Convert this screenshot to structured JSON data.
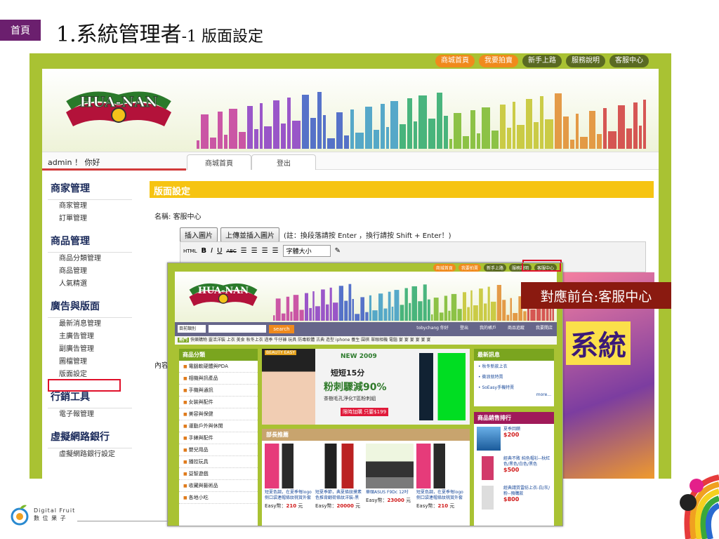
{
  "slide": {
    "home_tab": "首頁",
    "title_main": "1.系統管理者",
    "title_sub": "-1 版面設定"
  },
  "admin": {
    "topnav": [
      "商城首頁",
      "我要拍賣",
      "新手上路",
      "服務說明",
      "客服中心"
    ],
    "logo_text": "HUA-NAN",
    "greeting": "admin ！ 你好",
    "tabs": [
      "商城首頁",
      "登出"
    ],
    "sidebar": [
      {
        "head": "商家管理",
        "items": [
          "商家管理",
          "訂單管理"
        ]
      },
      {
        "head": "商品管理",
        "items": [
          "商品分類管理",
          "商品管理",
          "人氣精選"
        ]
      },
      {
        "head": "廣告與版面",
        "items": [
          "最新消息管理",
          "主廣告管理",
          "副廣告管理",
          "圖檔管理",
          "版面設定"
        ]
      },
      {
        "head": "行銷工具",
        "items": [
          "電子報管理"
        ]
      },
      {
        "head": "虛擬網路銀行",
        "items": [
          "虛擬網路銀行設定"
        ]
      }
    ],
    "content_header": "版面設定",
    "name_label": "名稱:",
    "name_value": "客服中心",
    "insert_image_button": "插入圖片",
    "upload_insert_button": "上傳並插入圖片",
    "note": "(註：換段落請按 Enter ，換行請按 Shift + Enter！)",
    "font_size_select": "字體大小",
    "content_label": "內容",
    "preview_text": "系統"
  },
  "shop": {
    "topnav": [
      "商城首頁",
      "我要拍賣",
      "新手上路",
      "服務說明",
      "客服中心"
    ],
    "logo_text": "HUA-NAN",
    "category_select": "目前類別",
    "search_button": "search",
    "user": "tobychang",
    "user_sub": "你好",
    "nav": [
      "登出",
      "我的帳戶",
      "商品追蹤",
      "我要開店"
    ],
    "hot_label": "熱門",
    "hot_text": "快樂購物 靈活洋裝 上衣 美食  秋冬上衣  過季  牛仔褲  玩具  防毒軟體  古典  造型  iphone  養生  圍棋  單眼相機  電腦  宴  宴  宴  宴  宴  宴",
    "category_head": "商品分類",
    "categories": [
      "電腦軟硬體與PDA",
      "相機與訊產品",
      "手機與通訊",
      "女裝與配件",
      "美容與保健",
      "運動戶外與休閒",
      "手錶與配件",
      "嬰兒用品",
      "播控玩具",
      "益智遊戲",
      "收藏與藝術品",
      "各地小吃"
    ],
    "ad": {
      "new": "NEW 2009",
      "line1": "短短15分",
      "line2": "粉刺驟減90%",
      "line3": "茶樹毛孔淨化T區粉刺組",
      "line4": "限時加購 只要$199",
      "brand": "BEAUTY EASY"
    },
    "rec_head": "部長推薦",
    "products": [
      {
        "desc": "短夏色調，在夏季每logo侧口袋連帽條紋桃賞外套",
        "price_label": "Easy幣：",
        "price": "210",
        "unit": "元"
      },
      {
        "desc": "短夏季節，典夏條紋摸素色推背翻荷條紋洋裝-黑",
        "price_label": "Easy幣：",
        "price": "20000",
        "unit": "元"
      },
      {
        "desc": "華碩ASUS F9Dc 12吋",
        "price_label": "Easy幣：",
        "price": "23000",
        "unit": "元"
      },
      {
        "desc": "短夏色調，在夏季每logo侧口袋連帽條紋桃賞外套",
        "price_label": "Easy幣：",
        "price": "210",
        "unit": "元"
      }
    ],
    "news_head": "最新訊息",
    "news": [
      "秋冬新款上衣",
      "衝浪就特賣",
      "SoEasy手機特賣"
    ],
    "news_more": "more...",
    "rank_head": "商品銷售排行",
    "rank": [
      {
        "desc": "夏季回饋",
        "price": "$200"
      },
      {
        "desc": "經典不敗 純色帽衫--秋紅色/黑色/白色/黑色",
        "price": "$500"
      },
      {
        "desc": "經典請質雷紡上衣-白/灰/粉--預購款",
        "price": "$800"
      }
    ]
  },
  "callout": "對應前台:客服中心",
  "footer": {
    "brand_en": "Digital Fruit",
    "brand_zh": "數 位 果 子"
  },
  "colors": {
    "frame_green": "#a9c233",
    "highlight_red": "#e0102a",
    "header_yellow": "#f6c412",
    "callout_bg": "#8a1a10",
    "home_purple": "#6b1f6e"
  }
}
